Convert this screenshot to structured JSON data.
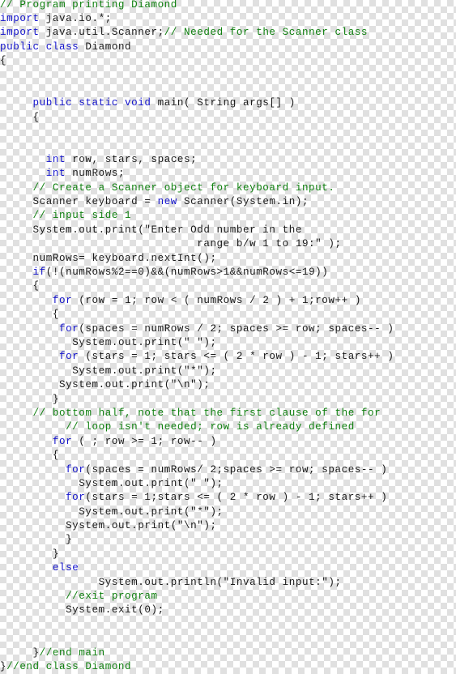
{
  "document": {
    "title": "Diamond.java",
    "language": "Java",
    "colors": {
      "keyword": "#1414cc",
      "comment": "#108010",
      "plain": "#1a1a1a",
      "background": "#ffffff",
      "checker": "#e0e0e0"
    }
  },
  "code": {
    "lines": [
      {
        "indent": 0,
        "segments": [
          {
            "type": "comment",
            "text": "// Program printing Diamond"
          }
        ]
      },
      {
        "indent": 0,
        "segments": [
          {
            "type": "keyword",
            "text": "import"
          },
          {
            "type": "plain",
            "text": " java.io.*;"
          }
        ]
      },
      {
        "indent": 0,
        "segments": [
          {
            "type": "keyword",
            "text": "import"
          },
          {
            "type": "plain",
            "text": " java.util.Scanner;"
          },
          {
            "type": "comment",
            "text": "// Needed for the Scanner class"
          }
        ]
      },
      {
        "indent": 0,
        "segments": [
          {
            "type": "keyword",
            "text": "public class"
          },
          {
            "type": "plain",
            "text": " Diamond"
          }
        ]
      },
      {
        "indent": 0,
        "segments": [
          {
            "type": "plain",
            "text": "{"
          }
        ]
      },
      {
        "indent": 0,
        "segments": [
          {
            "type": "plain",
            "text": ""
          }
        ]
      },
      {
        "indent": 0,
        "segments": [
          {
            "type": "plain",
            "text": ""
          }
        ]
      },
      {
        "indent": 5,
        "segments": [
          {
            "type": "keyword",
            "text": "public static void"
          },
          {
            "type": "plain",
            "text": " main( String args[] )"
          }
        ]
      },
      {
        "indent": 5,
        "segments": [
          {
            "type": "plain",
            "text": "{"
          }
        ]
      },
      {
        "indent": 0,
        "segments": [
          {
            "type": "plain",
            "text": ""
          }
        ]
      },
      {
        "indent": 0,
        "segments": [
          {
            "type": "plain",
            "text": ""
          }
        ]
      },
      {
        "indent": 7,
        "segments": [
          {
            "type": "keyword",
            "text": "int"
          },
          {
            "type": "plain",
            "text": " row, stars, spaces;"
          }
        ]
      },
      {
        "indent": 7,
        "segments": [
          {
            "type": "keyword",
            "text": "int"
          },
          {
            "type": "plain",
            "text": " numRows;"
          }
        ]
      },
      {
        "indent": 5,
        "segments": [
          {
            "type": "comment",
            "text": "// Create a Scanner object for keyboard input."
          }
        ]
      },
      {
        "indent": 5,
        "segments": [
          {
            "type": "plain",
            "text": "Scanner keyboard = "
          },
          {
            "type": "keyword",
            "text": "new"
          },
          {
            "type": "plain",
            "text": " Scanner(System.in);"
          }
        ]
      },
      {
        "indent": 5,
        "segments": [
          {
            "type": "comment",
            "text": "// input side 1"
          }
        ]
      },
      {
        "indent": 5,
        "segments": [
          {
            "type": "plain",
            "text": "System.out.print(\"Enter Odd number in the"
          }
        ]
      },
      {
        "indent": 30,
        "segments": [
          {
            "type": "plain",
            "text": "range b/w 1 to 19:\" );"
          }
        ]
      },
      {
        "indent": 5,
        "segments": [
          {
            "type": "plain",
            "text": "numRows= keyboard.nextInt();"
          }
        ]
      },
      {
        "indent": 5,
        "segments": [
          {
            "type": "keyword",
            "text": "if"
          },
          {
            "type": "plain",
            "text": "(!(numRows%2==0)&&(numRows>1&&numRows<=19))"
          }
        ]
      },
      {
        "indent": 5,
        "segments": [
          {
            "type": "plain",
            "text": "{"
          }
        ]
      },
      {
        "indent": 8,
        "segments": [
          {
            "type": "keyword",
            "text": "for"
          },
          {
            "type": "plain",
            "text": " (row = 1; row < ( numRows / 2 ) + 1;row++ )"
          }
        ]
      },
      {
        "indent": 8,
        "segments": [
          {
            "type": "plain",
            "text": "{"
          }
        ]
      },
      {
        "indent": 9,
        "segments": [
          {
            "type": "keyword",
            "text": "for"
          },
          {
            "type": "plain",
            "text": "(spaces = numRows / 2; spaces >= row; spaces-- )"
          }
        ]
      },
      {
        "indent": 11,
        "segments": [
          {
            "type": "plain",
            "text": "System.out.print(\" \");"
          }
        ]
      },
      {
        "indent": 9,
        "segments": [
          {
            "type": "keyword",
            "text": "for"
          },
          {
            "type": "plain",
            "text": " (stars = 1; stars <= ( 2 * row ) - 1; stars++ )"
          }
        ]
      },
      {
        "indent": 11,
        "segments": [
          {
            "type": "plain",
            "text": "System.out.print(\"*\");"
          }
        ]
      },
      {
        "indent": 9,
        "segments": [
          {
            "type": "plain",
            "text": "System.out.print(\"\\n\");"
          }
        ]
      },
      {
        "indent": 8,
        "segments": [
          {
            "type": "plain",
            "text": "}"
          }
        ]
      },
      {
        "indent": 5,
        "segments": [
          {
            "type": "comment",
            "text": "// bottom half, note that the first clause of the for"
          }
        ]
      },
      {
        "indent": 10,
        "segments": [
          {
            "type": "comment",
            "text": "// loop isn't needed; row is already defined"
          }
        ]
      },
      {
        "indent": 8,
        "segments": [
          {
            "type": "keyword",
            "text": "for"
          },
          {
            "type": "plain",
            "text": " ( ; row >= 1; row-- )"
          }
        ]
      },
      {
        "indent": 8,
        "segments": [
          {
            "type": "plain",
            "text": "{"
          }
        ]
      },
      {
        "indent": 10,
        "segments": [
          {
            "type": "keyword",
            "text": "for"
          },
          {
            "type": "plain",
            "text": "(spaces = numRows/ 2;spaces >= row; spaces-- )"
          }
        ]
      },
      {
        "indent": 12,
        "segments": [
          {
            "type": "plain",
            "text": "System.out.print(\" \");"
          }
        ]
      },
      {
        "indent": 10,
        "segments": [
          {
            "type": "keyword",
            "text": "for"
          },
          {
            "type": "plain",
            "text": "(stars = 1;stars <= ( 2 * row ) - 1; stars++ )"
          }
        ]
      },
      {
        "indent": 12,
        "segments": [
          {
            "type": "plain",
            "text": "System.out.print(\"*\");"
          }
        ]
      },
      {
        "indent": 10,
        "segments": [
          {
            "type": "plain",
            "text": "System.out.print(\"\\n\");"
          }
        ]
      },
      {
        "indent": 10,
        "segments": [
          {
            "type": "plain",
            "text": "}"
          }
        ]
      },
      {
        "indent": 8,
        "segments": [
          {
            "type": "plain",
            "text": "}"
          }
        ]
      },
      {
        "indent": 8,
        "segments": [
          {
            "type": "keyword",
            "text": "else"
          }
        ]
      },
      {
        "indent": 15,
        "segments": [
          {
            "type": "plain",
            "text": "System.out.println(\"Invalid input:\");"
          }
        ]
      },
      {
        "indent": 10,
        "segments": [
          {
            "type": "comment",
            "text": "//exit program"
          }
        ]
      },
      {
        "indent": 10,
        "segments": [
          {
            "type": "plain",
            "text": "System.exit(0);"
          }
        ]
      },
      {
        "indent": 0,
        "segments": [
          {
            "type": "plain",
            "text": ""
          }
        ]
      },
      {
        "indent": 0,
        "segments": [
          {
            "type": "plain",
            "text": ""
          }
        ]
      },
      {
        "indent": 5,
        "segments": [
          {
            "type": "plain",
            "text": "}"
          },
          {
            "type": "comment",
            "text": "//end main"
          }
        ]
      },
      {
        "indent": 0,
        "segments": [
          {
            "type": "plain",
            "text": "}"
          },
          {
            "type": "comment",
            "text": "//end class Diamond"
          }
        ]
      }
    ]
  }
}
